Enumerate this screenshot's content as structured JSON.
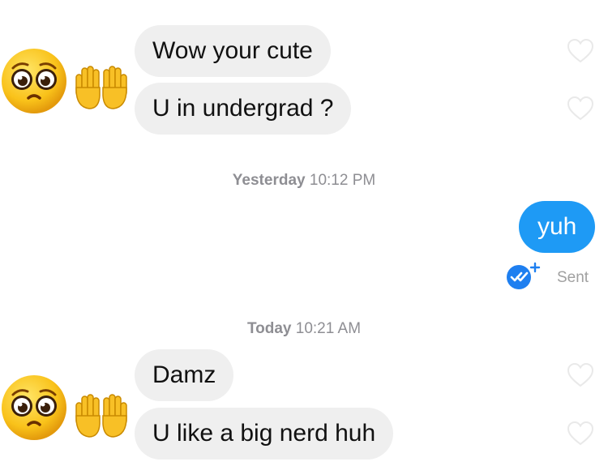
{
  "colors": {
    "incoming_bubble": "#efefef",
    "outgoing_bubble": "#1e9af5",
    "timestamp_text": "#8e8e93",
    "sent_badge": "#1e7ff0"
  },
  "groups": [
    {
      "avatar_icon": "pleading-face-icon",
      "hands_icon": "raised-hands-icon",
      "messages": [
        "Wow your cute",
        "U in undergrad ?"
      ]
    },
    {
      "avatar_icon": "pleading-face-icon",
      "hands_icon": "raised-hands-icon",
      "messages": [
        "Damz",
        "U like a big nerd huh"
      ]
    }
  ],
  "timestamps": [
    {
      "day": "Yesterday",
      "time": "10:12 PM"
    },
    {
      "day": "Today",
      "time": "10:21 AM"
    }
  ],
  "outgoing": {
    "message": "yuh",
    "status_icon": "double-check-badge-icon",
    "status": "Sent"
  }
}
